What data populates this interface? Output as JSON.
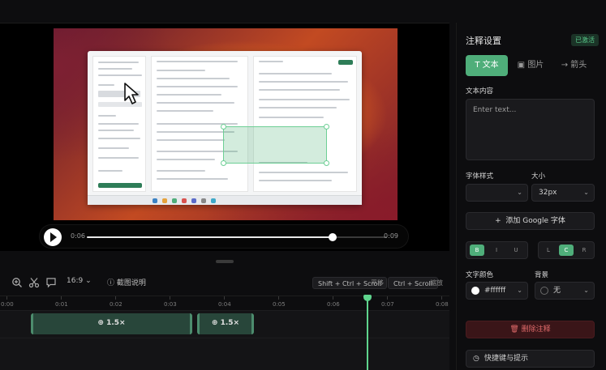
{
  "player": {
    "current_time": "0:06",
    "end_time": "0:09",
    "progress_fraction": 0.82
  },
  "toolbar": {
    "ratio": "16:9",
    "help": "截图说明",
    "shortcut_zoom": "Shift + Ctrl + Scroll",
    "shortcut_zoom_label": "平移",
    "shortcut_scroll": "Ctrl + Scroll",
    "shortcut_scroll_label": "缩放"
  },
  "timeline": {
    "ticks": [
      "0:00",
      "0:01",
      "0:02",
      "0:03",
      "0:04",
      "0:05",
      "0:06",
      "0:07",
      "0:08"
    ],
    "clips": [
      {
        "label": "1.5×"
      },
      {
        "label": "1.5×"
      }
    ]
  },
  "panel": {
    "title": "注释设置",
    "badge": "已激活",
    "tabs": [
      {
        "label": "文本",
        "icon": "text-icon",
        "active": true
      },
      {
        "label": "图片",
        "icon": "image-icon",
        "active": false
      },
      {
        "label": "箭头",
        "icon": "arrow-icon",
        "active": false
      }
    ],
    "text_content_label": "文本内容",
    "text_placeholder": "Enter text...",
    "font_style_label": "字体样式",
    "font_style_value": "",
    "size_label": "大小",
    "size_value": "32px",
    "add_font_label": "添加 Google 字体",
    "style_buttons": [
      "B",
      "I",
      "U"
    ],
    "align_buttons": [
      "L",
      "C",
      "R"
    ],
    "text_color_label": "文字颜色",
    "text_color_value": "#ffffff",
    "background_label": "背景",
    "background_value": "无",
    "delete_label": "删除注释",
    "shortcut_label": "快捷键与提示"
  },
  "colors": {
    "accent": "#4fae7a",
    "danger": "#e06a6a"
  }
}
